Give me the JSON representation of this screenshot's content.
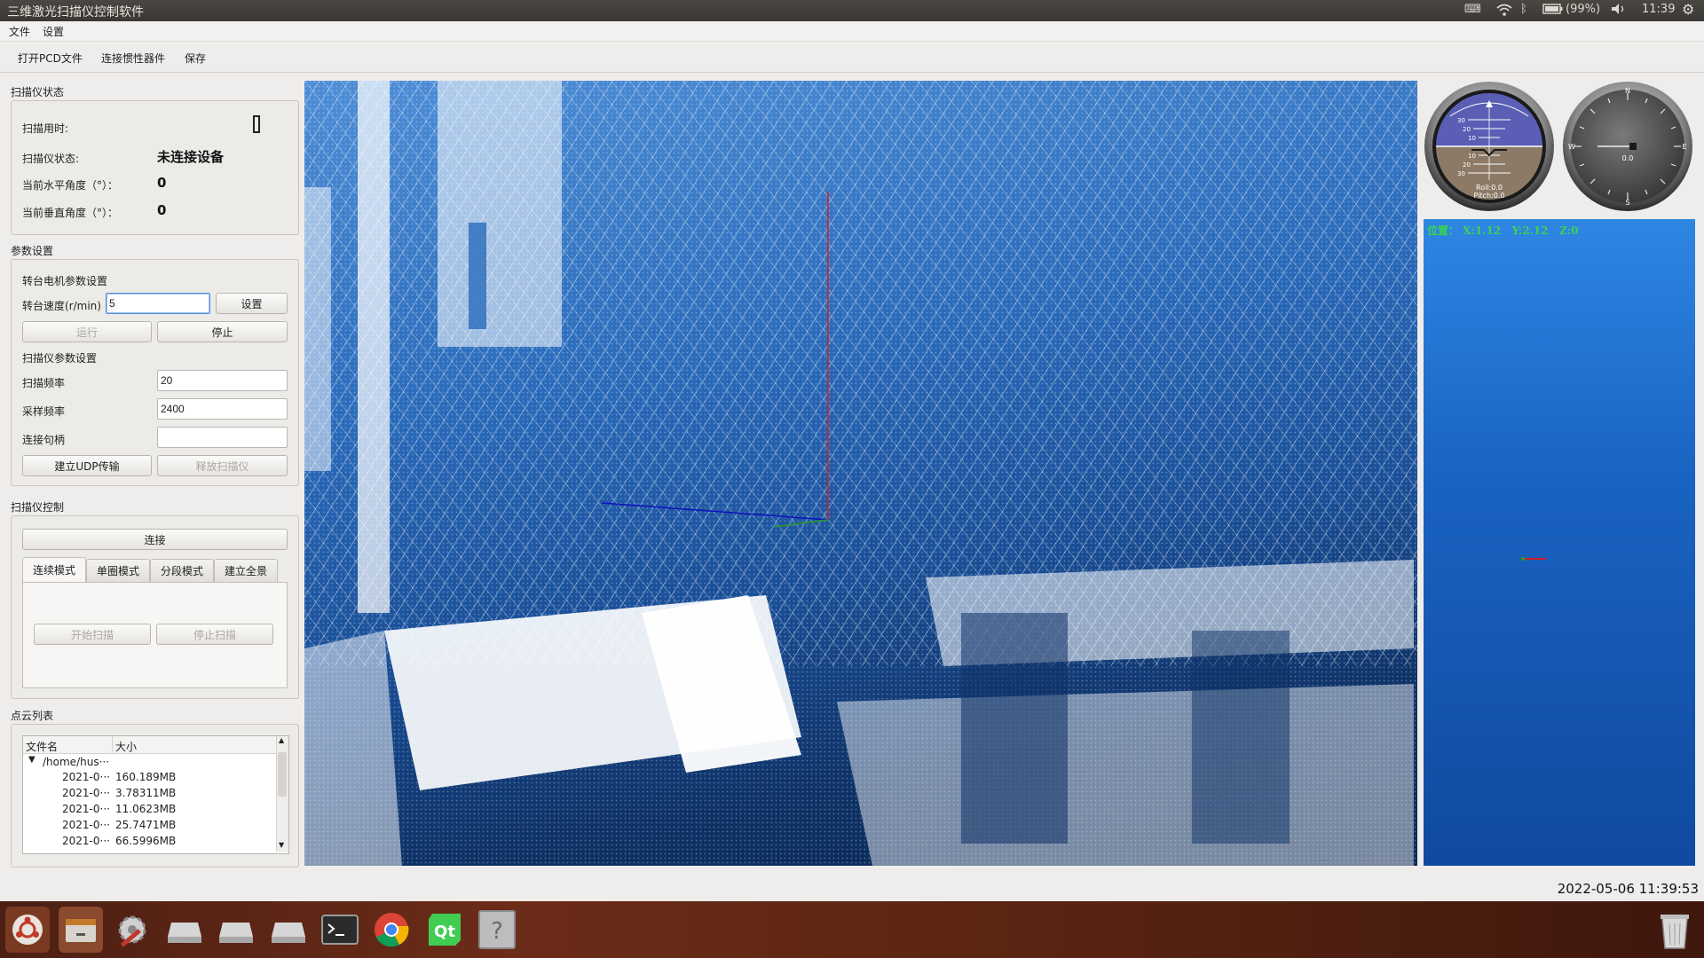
{
  "window": {
    "title": "三维激光扫描仪控制软件",
    "indicators": {
      "battery": "(99%)",
      "time": "11:39"
    }
  },
  "menu": {
    "file": "文件",
    "settings": "设置"
  },
  "toolbar": {
    "open_pcd": "打开PCD文件",
    "connect_imu": "连接惯性器件",
    "save": "保存"
  },
  "status": {
    "group_title": "扫描仪状态",
    "scan_time_label": "扫描用时:",
    "scanner_state_label": "扫描仪状态:",
    "scanner_state_value": "未连接设备",
    "h_angle_label": "当前水平角度（°）：",
    "h_angle_value": "0",
    "v_angle_label": "当前垂直角度（°）：",
    "v_angle_value": "0"
  },
  "params": {
    "group_title": "参数设置",
    "motor_title": "转台电机参数设置",
    "speed_label": "转台速度(r/min)",
    "speed_value": "5",
    "set_button": "设置",
    "run_button": "运行",
    "stop_button": "停止",
    "scanner_title": "扫描仪参数设置",
    "scan_freq_label": "扫描频率",
    "scan_freq_value": "20",
    "sample_freq_label": "采样频率",
    "sample_freq_value": "2400",
    "handle_label": "连接句柄",
    "handle_value": "",
    "udp_button": "建立UDP传输",
    "release_button": "释放扫描仪"
  },
  "control": {
    "group_title": "扫描仪控制",
    "connect_button": "连接",
    "tabs": [
      "连续模式",
      "单圈模式",
      "分段模式",
      "建立全景"
    ],
    "start_button": "开始扫描",
    "stop_button": "停止扫描"
  },
  "cloud_list": {
    "group_title": "点云列表",
    "headers": [
      "文件名",
      "大小"
    ],
    "root": "/home/hus···",
    "rows": [
      {
        "name": "2021-0···",
        "size": "160.189MB"
      },
      {
        "name": "2021-0···",
        "size": "3.78311MB"
      },
      {
        "name": "2021-0···",
        "size": "11.0623MB"
      },
      {
        "name": "2021-0···",
        "size": "25.7471MB"
      },
      {
        "name": "2021-0···",
        "size": "66.5996MB"
      }
    ]
  },
  "attitude": {
    "roll_text": "Roll:0.0",
    "pitch_text": "Pitch:0.0",
    "pitch_marks": [
      "30",
      "20",
      "10",
      "10",
      "20",
      "30"
    ],
    "roll": 0.0,
    "pitch": 0.0
  },
  "compass": {
    "heading_text": "0.0",
    "n": "N",
    "e": "E",
    "s": "S",
    "w": "W",
    "heading": 0.0
  },
  "position": {
    "text": "位置： X:1.12   Y:2.12   Z:0"
  },
  "statusbar": {
    "datetime": "2022-05-06 11:39:53"
  },
  "colors": {
    "viewer_top": "#4e8ed6",
    "viewer_bottom": "#0a2652",
    "position_text": "#39d353",
    "axis_x": "#d0202a",
    "axis_y": "#2a9a2a",
    "axis_z": "#1010c0"
  }
}
